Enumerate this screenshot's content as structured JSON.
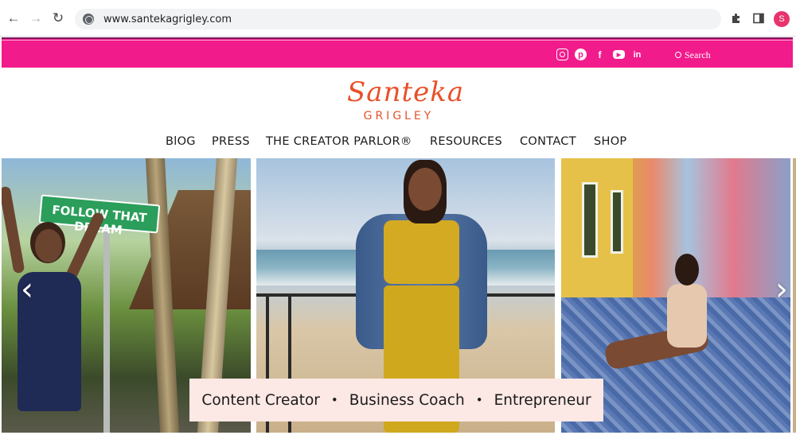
{
  "browser": {
    "url": "www.santekagrigley.com",
    "back_icon": "←",
    "forward_icon": "→",
    "reload_icon": "↻",
    "extensions_icon": "puzzle-icon",
    "sidepanel_icon": "panel-icon",
    "profile_initial": "S"
  },
  "topbar": {
    "color": "#f21b8c",
    "social": [
      {
        "name": "instagram",
        "glyph": ""
      },
      {
        "name": "pinterest",
        "glyph": "p"
      },
      {
        "name": "facebook",
        "glyph": "f"
      },
      {
        "name": "youtube",
        "glyph": "▶"
      },
      {
        "name": "linkedin",
        "glyph": "in"
      }
    ],
    "search_label": "Search"
  },
  "logo": {
    "script": "Santeka",
    "sub": "GRIGLEY",
    "color": "#e8502a"
  },
  "menu": {
    "items": [
      "BlOG",
      "PRESS",
      "THE CREATOR PARLOR®",
      "RESOURCES",
      "CONTACT",
      "SHOP"
    ]
  },
  "hero": {
    "sign_text": "FOLLOW THAT DREAM",
    "prev_arrow": "‹",
    "next_arrow": "›",
    "tagline": {
      "part1": "Content Creator",
      "part2": "Business Coach",
      "part3": "Entrepreneur",
      "separator": "•"
    }
  }
}
